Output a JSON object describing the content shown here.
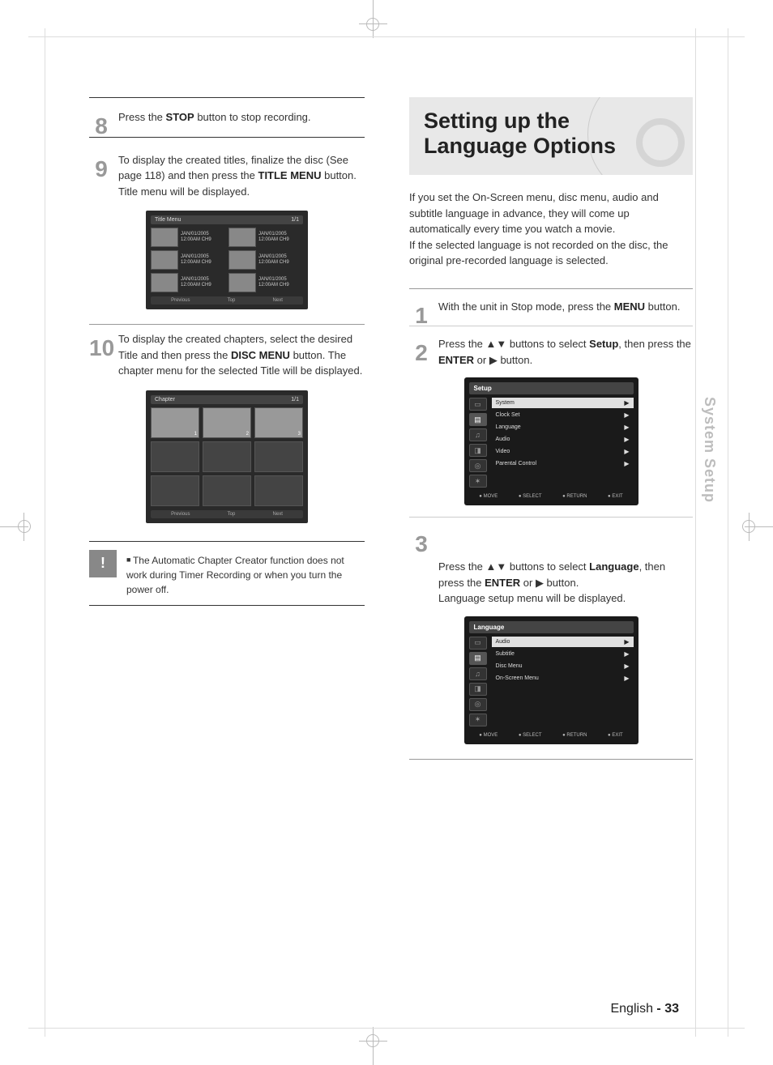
{
  "left": {
    "step8": {
      "num": "8",
      "pre": "Press the ",
      "key": "STOP",
      "post": " button to stop recording."
    },
    "step9": {
      "num": "9",
      "line1": "To display the created titles, finalize the disc (See page 118) and then press the ",
      "key": "TITLE MENU",
      "line2": " button. Title menu will be displayed."
    },
    "step10": {
      "num": "10",
      "line1": "To display the created chapters, select the desired Title and then press the ",
      "key": "DISC MENU",
      "line2": " button. The chapter menu for the selected Title will be displayed."
    },
    "note": "The Automatic Chapter Creator function does not work during Timer Recording or when you turn the power off.",
    "note_label": "NOTE"
  },
  "title_menu": {
    "header_left": "Title Menu",
    "header_right": "1/1",
    "cells": [
      {
        "date": "JAN/01/2005",
        "time": "12:00AM CH9"
      },
      {
        "date": "JAN/01/2005",
        "time": "12:00AM CH9"
      },
      {
        "date": "JAN/01/2005",
        "time": "12:00AM CH9"
      },
      {
        "date": "JAN/01/2005",
        "time": "12:00AM CH9"
      },
      {
        "date": "JAN/01/2005",
        "time": "12:00AM CH9"
      },
      {
        "date": "JAN/01/2005",
        "time": "12:00AM CH9"
      }
    ],
    "legend": [
      "Previous",
      "Top",
      "Next"
    ]
  },
  "chapter_menu": {
    "header_left": "Chapter",
    "header_right": "1/1",
    "nums": [
      "1",
      "2",
      "3"
    ],
    "legend": [
      "Previous",
      "Top",
      "Next"
    ]
  },
  "right": {
    "heading": "Setting up the Language Options",
    "intro": "If you set the On-Screen menu, disc menu, audio and subtitle language in advance, they will come up automatically every time you watch a movie.\nIf the selected language is not recorded on the disc, the original pre-recorded language is selected.",
    "step1": {
      "num": "1",
      "pre": "With the unit in Stop mode, press the ",
      "key": "MENU",
      "post": " button."
    },
    "step2": {
      "num": "2",
      "pre": "Press the ▲▼ buttons to select ",
      "sel": "Setup",
      "mid": ", then press the ",
      "key": "ENTER",
      "post": " or ▶ button."
    },
    "step3": {
      "num": "3",
      "pre": "Press the ▲▼ buttons to select ",
      "sel": "Language",
      "mid": ", then press the ",
      "key": "ENTER",
      "post": " or ▶ button.\nLanguage setup menu will be displayed."
    }
  },
  "osd1": {
    "title": "Setup",
    "items": [
      {
        "label": "System",
        "val": "▶"
      },
      {
        "label": "Clock Set",
        "val": "▶"
      },
      {
        "label": "Language",
        "val": "▶",
        "note": "✓"
      },
      {
        "label": "Audio",
        "val": "▶"
      },
      {
        "label": "Video",
        "val": "▶"
      },
      {
        "label": "Parental Control",
        "val": "▶"
      }
    ],
    "legend": [
      "MOVE",
      "SELECT",
      "RETURN",
      "EXIT"
    ]
  },
  "osd2": {
    "title": "Language",
    "items": [
      {
        "label": "Audio",
        "val": "▶"
      },
      {
        "label": "Subtitle",
        "val": "▶"
      },
      {
        "label": "Disc Menu",
        "val": "▶"
      },
      {
        "label": "On-Screen Menu",
        "val": "▶"
      }
    ],
    "legend": [
      "MOVE",
      "SELECT",
      "RETURN",
      "EXIT"
    ]
  },
  "side_tab": "System Setup",
  "footer": {
    "lang": "English",
    "page": "- 33"
  }
}
